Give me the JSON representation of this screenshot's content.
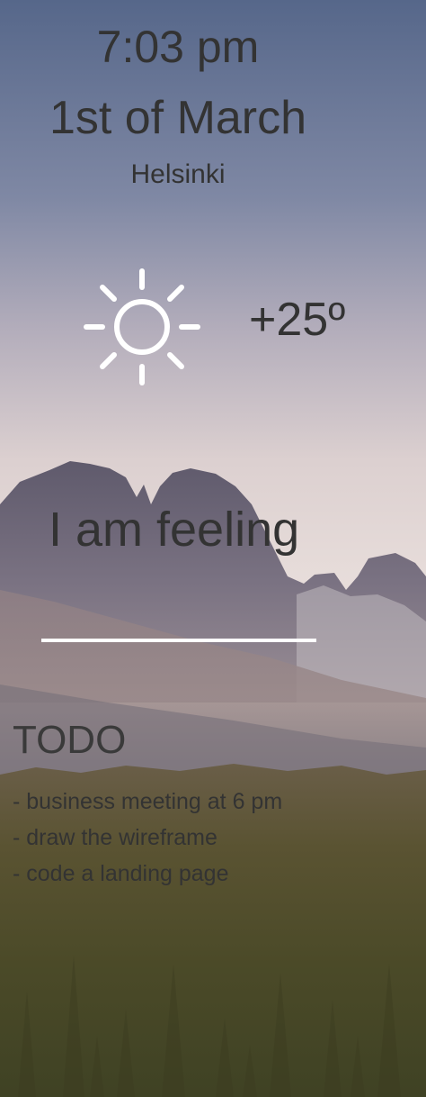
{
  "clock": {
    "time": "7:03 pm",
    "date": "1st of March",
    "city": "Helsinki"
  },
  "weather": {
    "icon": "sun-icon",
    "temperature": "+25º"
  },
  "mood": {
    "label": "I am feeling",
    "input_value": ""
  },
  "todo": {
    "title": "TODO",
    "items": [
      "- business meeting at 6 pm",
      "- draw the wireframe",
      "- code a landing page"
    ]
  },
  "colors": {
    "text": "#333333",
    "sky_top": "#5a6a8c",
    "sky_bottom": "#e8dedc",
    "mountain": "#6b6678",
    "forest": "#4a4a28",
    "underline": "#ffffff",
    "icon": "#ffffff"
  }
}
